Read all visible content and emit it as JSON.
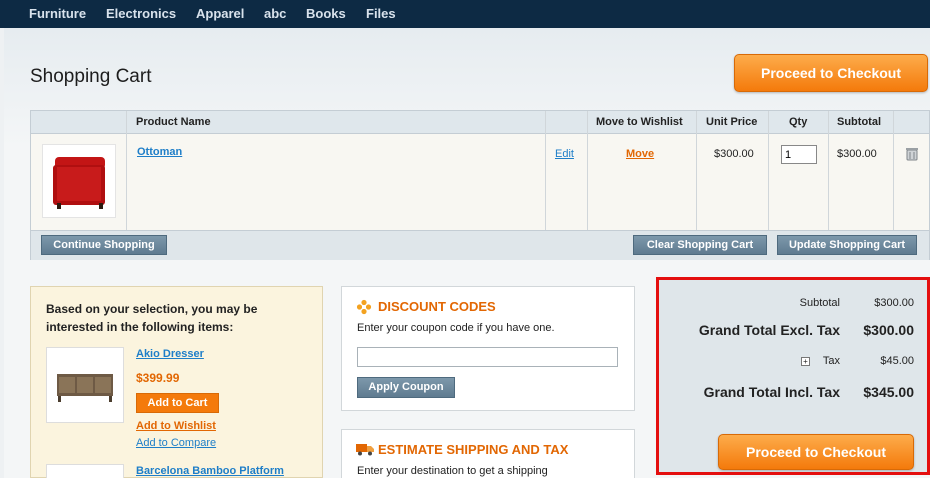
{
  "nav": [
    "Furniture",
    "Electronics",
    "Apparel",
    "abc",
    "Books",
    "Files"
  ],
  "page_title": "Shopping Cart",
  "checkout_label": "Proceed to Checkout",
  "table": {
    "headers": {
      "product_name": "Product Name",
      "move_to_wishlist": "Move to Wishlist",
      "unit_price": "Unit Price",
      "qty": "Qty",
      "subtotal": "Subtotal"
    },
    "item": {
      "name": "Ottoman",
      "edit": "Edit",
      "move": "Move",
      "unit_price": "$300.00",
      "qty": "1",
      "subtotal": "$300.00"
    },
    "continue_label": "Continue Shopping",
    "clear_label": "Clear Shopping Cart",
    "update_label": "Update Shopping Cart"
  },
  "upsell": {
    "heading": "Based on your selection, you may be interested in the following items:",
    "product1": {
      "name": "Akio Dresser",
      "price": "$399.99",
      "add_to_cart": "Add to Cart",
      "add_to_wishlist": "Add to Wishlist",
      "add_to_compare": "Add to Compare"
    },
    "product2": {
      "name": "Barcelona Bamboo Platform"
    }
  },
  "discount": {
    "title": "DISCOUNT CODES",
    "desc": "Enter your coupon code if you have one.",
    "input_value": "",
    "apply_label": "Apply Coupon"
  },
  "shipping": {
    "title": "ESTIMATE SHIPPING AND TAX",
    "desc": "Enter your destination to get a shipping"
  },
  "totals": {
    "subtotal_label": "Subtotal",
    "subtotal": "$300.00",
    "gt_excl_label": "Grand Total Excl. Tax",
    "gt_excl": "$300.00",
    "tax_label": "Tax",
    "tax": "$45.00",
    "gt_incl_label": "Grand Total Incl. Tax",
    "gt_incl": "$345.00"
  },
  "colors": {
    "nav_bg": "#0d2a44",
    "accent_orange": "#f47a0b",
    "link_blue": "#1e7ec8",
    "highlight_red": "#e40f0f"
  }
}
